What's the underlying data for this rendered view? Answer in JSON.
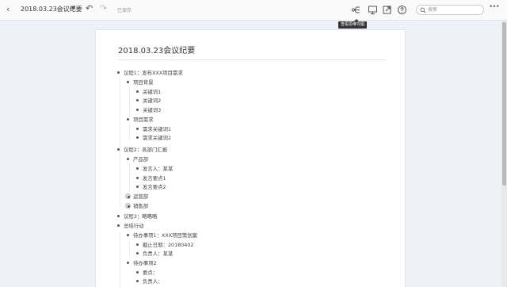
{
  "toolbar": {
    "back_icon": "chevron-left",
    "doc_title": "2018.03.23会议纪要",
    "save_status": "已保存",
    "search_placeholder": "搜索",
    "tooltip": "查看思维导图"
  },
  "document": {
    "title": "2018.03.23会议纪要"
  },
  "outline": [
    {
      "text": "议程1：发布XXX项目需求"
    },
    {
      "text": "项目背景"
    },
    {
      "text": "关键词1"
    },
    {
      "text": "关键词2"
    },
    {
      "text": "关键词3"
    },
    {
      "text": "项目需求"
    },
    {
      "text": "需求关键词1"
    },
    {
      "text": "需求关键词2"
    },
    {
      "text": "议程2：各部门汇报"
    },
    {
      "text": "产品部"
    },
    {
      "text": "发言人：某某"
    },
    {
      "text": "发言要点1"
    },
    {
      "text": "发言要点2"
    },
    {
      "text": "运营部"
    },
    {
      "text": "销售部"
    },
    {
      "text": "议程3：略略略"
    },
    {
      "text": "总结行动"
    },
    {
      "text": "待办事项1：XXX项目策划案"
    },
    {
      "text": "截止日期：20180402"
    },
    {
      "text": "负责人：某某"
    },
    {
      "text": "待办事项2"
    },
    {
      "text": "要点："
    },
    {
      "text": "负责人："
    }
  ]
}
